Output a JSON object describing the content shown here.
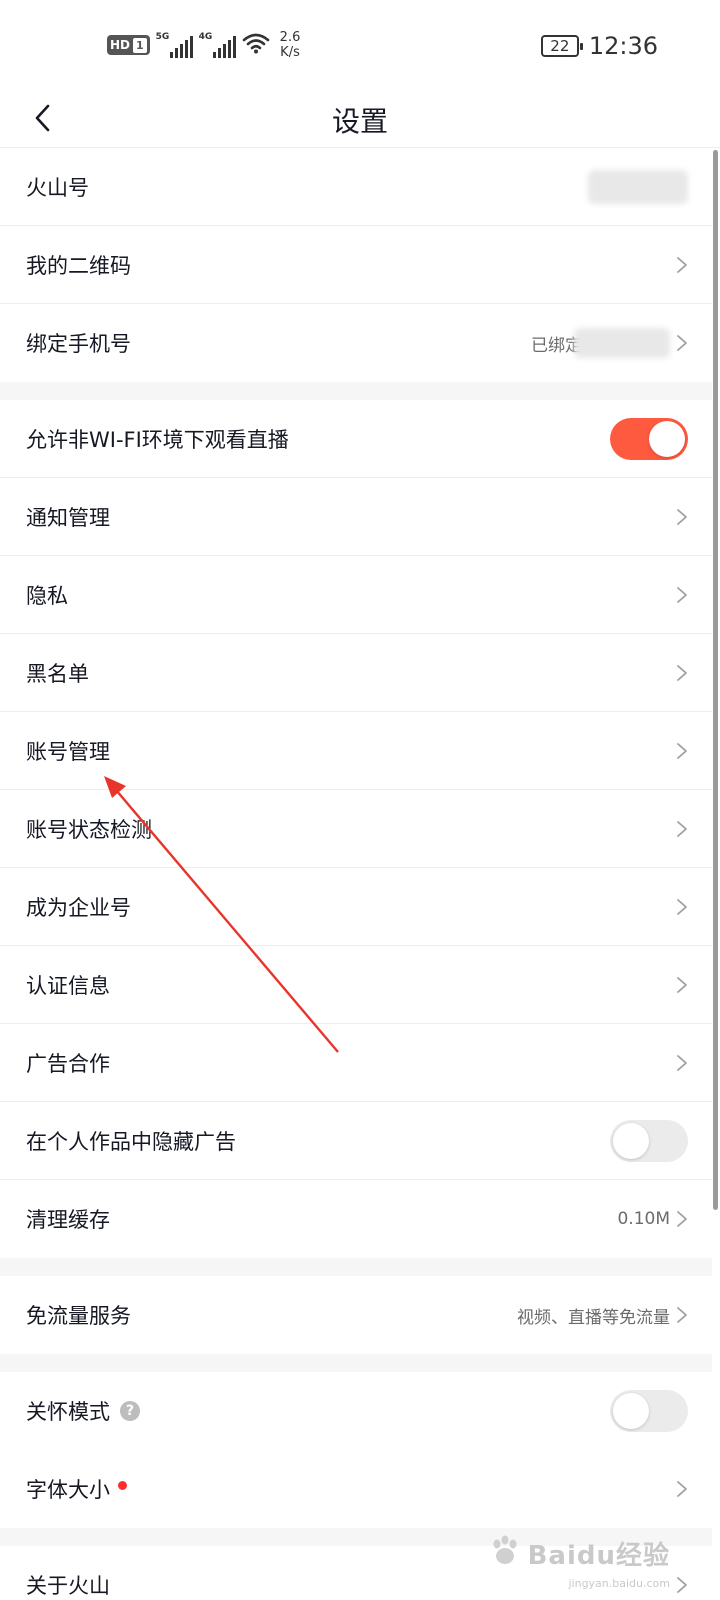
{
  "status_bar": {
    "hd": "HD",
    "sim": "1",
    "net1": "5G",
    "net2": "4G",
    "speed_value": "2.6",
    "speed_unit": "K/s",
    "battery": "22",
    "time": "12:36"
  },
  "nav": {
    "title": "设置"
  },
  "rows": {
    "huoshan_id": "火山号",
    "qr_code": "我的二维码",
    "bind_phone": "绑定手机号",
    "bind_phone_value": "已绑定",
    "wifi_live": "允许非WI-FI环境下观看直播",
    "notifications": "通知管理",
    "privacy": "隐私",
    "blacklist": "黑名单",
    "account_manage": "账号管理",
    "account_status": "账号状态检测",
    "enterprise": "成为企业号",
    "verification": "认证信息",
    "ad_coop": "广告合作",
    "hide_ads": "在个人作品中隐藏广告",
    "clear_cache": "清理缓存",
    "cache_size": "0.10M",
    "free_data": "免流量服务",
    "free_data_value": "视频、直播等免流量",
    "care_mode": "关怀模式",
    "font_size": "字体大小",
    "about": "关于火山"
  },
  "toggles": {
    "wifi_live": true,
    "hide_ads": false,
    "care_mode": false
  },
  "watermark": {
    "main": "Baidu经验",
    "sub": "jingyan.baidu.com"
  },
  "colors": {
    "accent": "#fe5a40",
    "annotation_arrow": "#e8352b"
  }
}
